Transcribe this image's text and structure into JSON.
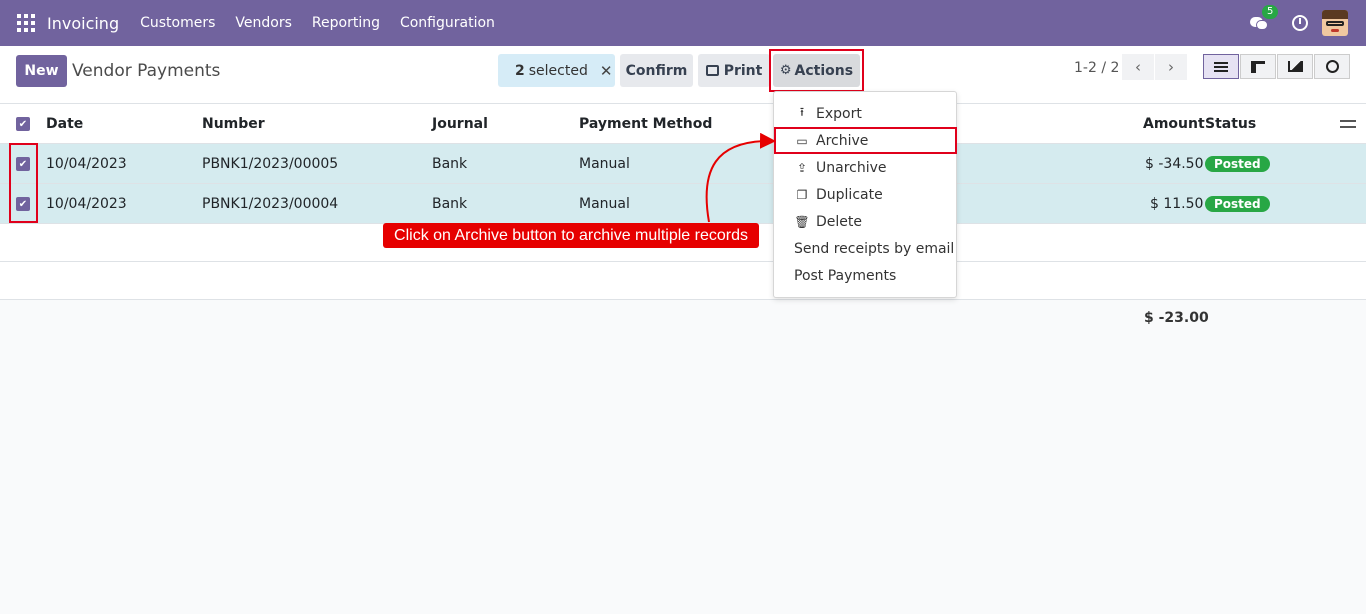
{
  "navbar": {
    "app_name": "Invoicing",
    "menu": [
      "Customers",
      "Vendors",
      "Reporting",
      "Configuration"
    ],
    "chat_count": "5"
  },
  "control": {
    "new_label": "New",
    "title": "Vendor Payments",
    "selected_count": "2",
    "selected_label": "selected",
    "confirm_label": "Confirm",
    "print_label": "Print",
    "actions_label": "Actions",
    "pager": "1-2 / 2"
  },
  "table": {
    "columns": [
      "Date",
      "Number",
      "Journal",
      "Payment Method",
      "Amount",
      "Status"
    ],
    "rows": [
      {
        "date": "10/04/2023",
        "number": "PBNK1/2023/00005",
        "journal": "Bank",
        "method": "Manual",
        "amount": "$ -34.50",
        "status": "Posted"
      },
      {
        "date": "10/04/2023",
        "number": "PBNK1/2023/00004",
        "journal": "Bank",
        "method": "Manual",
        "amount": "$ 11.50",
        "status": "Posted"
      }
    ],
    "total": "$ -23.00"
  },
  "actions_menu": [
    {
      "label": "Export",
      "icon": "upload-icon"
    },
    {
      "label": "Archive",
      "icon": "inbox-icon"
    },
    {
      "label": "Unarchive",
      "icon": "unarchive-icon"
    },
    {
      "label": "Duplicate",
      "icon": "copy-icon"
    },
    {
      "label": "Delete",
      "icon": "trash-icon"
    },
    {
      "label": "Send receipts by email",
      "icon": ""
    },
    {
      "label": "Post Payments",
      "icon": ""
    }
  ],
  "annotation": "Click on Archive button to archive multiple records",
  "colors": {
    "brand": "#71639e",
    "highlight": "#e0001b",
    "posted": "#28a745",
    "selected_row": "#d5ebef"
  }
}
